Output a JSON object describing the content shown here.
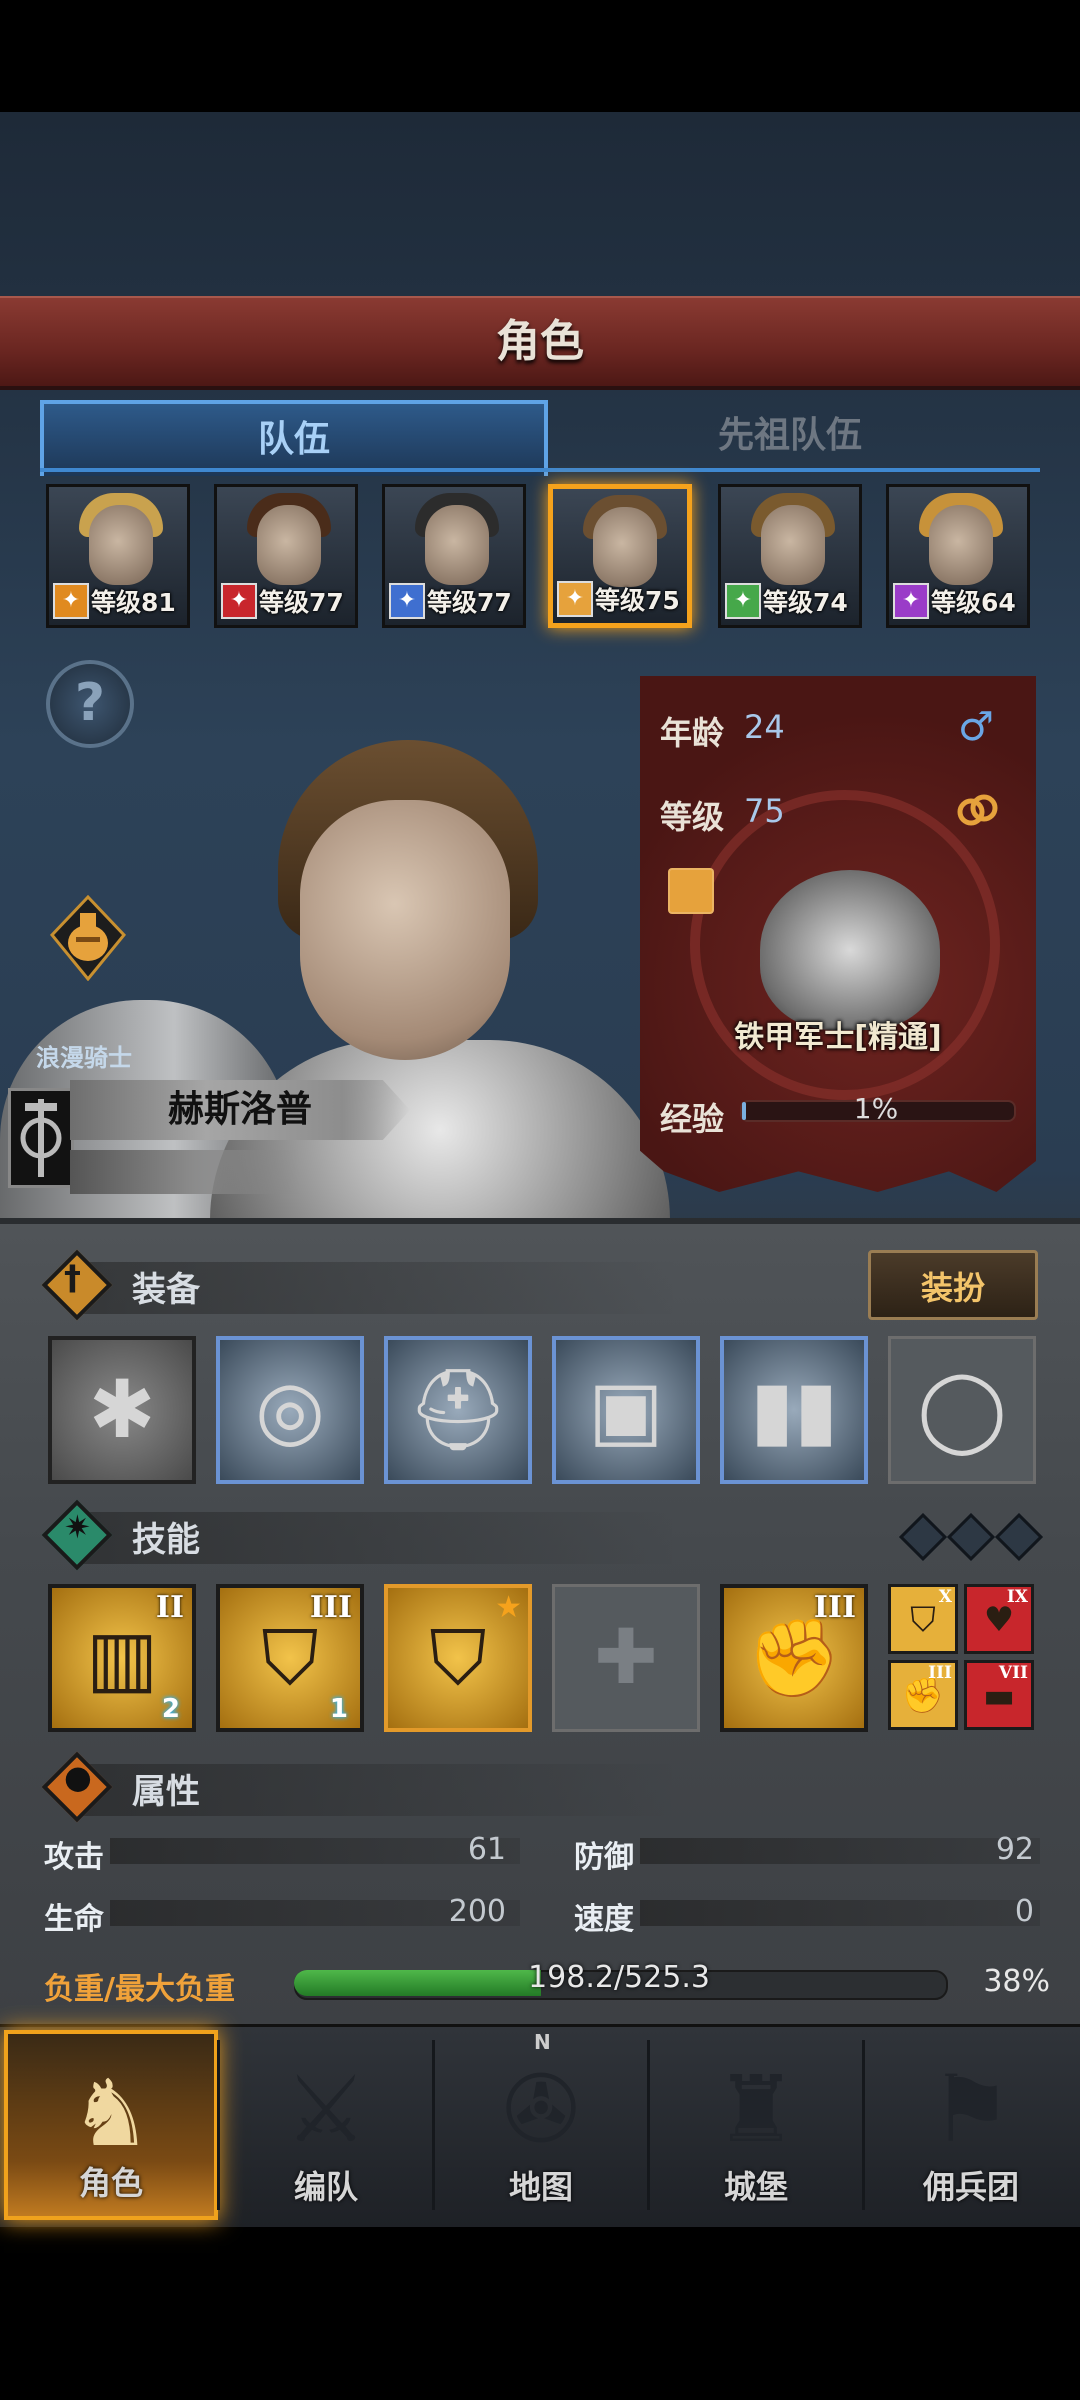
{
  "title": "角色",
  "tabs": [
    {
      "label": "队伍",
      "active": true
    },
    {
      "label": "先祖队伍",
      "active": false
    }
  ],
  "team": [
    {
      "level_label": "等级81",
      "class_icon": "lance-icon",
      "class_color": "#e08a20",
      "hair": "#c9a24e",
      "selected": false
    },
    {
      "level_label": "等级77",
      "class_icon": "horse-icon",
      "class_color": "#c8262c",
      "hair": "#4a2c1a",
      "selected": false
    },
    {
      "level_label": "等级77",
      "class_icon": "sword-icon",
      "class_color": "#3f6fd0",
      "hair": "#2c2c2c",
      "selected": false
    },
    {
      "level_label": "等级75",
      "class_icon": "shield-star-icon",
      "class_color": "#e6a23c",
      "hair": "#6b4f31",
      "selected": true
    },
    {
      "level_label": "等级74",
      "class_icon": "crossbow-icon",
      "class_color": "#46a84a",
      "hair": "#7a5a2e",
      "selected": false
    },
    {
      "level_label": "等级64",
      "class_icon": "staff-icon",
      "class_color": "#9a3cc8",
      "hair": "#c7923a",
      "selected": false
    }
  ],
  "hero": {
    "class_name": "浪漫骑士",
    "name": "赫斯洛普"
  },
  "info": {
    "age_label": "年龄",
    "age_value": "24",
    "gender_icon": "male-icon",
    "level_label": "等级",
    "level_value": "75",
    "ring_icon": "rings-icon",
    "unit_name": "铁甲军士[精通]",
    "exp_label": "经验",
    "exp_value": "1%",
    "exp_fraction": 0.01
  },
  "equipment": {
    "title": "装备",
    "dress_button": "装扮",
    "slots": [
      {
        "name": "flail-icon",
        "glyph": "✱",
        "style": "dark"
      },
      {
        "name": "round-shield-icon",
        "glyph": "◎",
        "style": "blue"
      },
      {
        "name": "great-helm-icon",
        "glyph": "⛑",
        "style": "blue"
      },
      {
        "name": "plate-armor-icon",
        "glyph": "▣",
        "style": "blue"
      },
      {
        "name": "greaves-icon",
        "glyph": "▮▮",
        "style": "blue"
      },
      {
        "name": "ring-slot-icon",
        "glyph": "◯",
        "style": "empty"
      }
    ]
  },
  "skills": {
    "title": "技能",
    "items": [
      {
        "name": "shield-wall-skill-icon",
        "roman": "II",
        "count": "2",
        "glyph": "▥",
        "style": "dark"
      },
      {
        "name": "shield-bash-skill-icon",
        "roman": "III",
        "count": "1",
        "glyph": "⛉",
        "style": "dark"
      },
      {
        "name": "shield-strength-skill-icon",
        "roman": "",
        "count": "",
        "glyph": "⛉",
        "style": "orange"
      },
      {
        "name": "empty-skill-slot-icon",
        "roman": "",
        "count": "",
        "glyph": "✚",
        "style": "empty"
      },
      {
        "name": "strength-fist-skill-icon",
        "roman": "III",
        "count": "",
        "glyph": "✊",
        "style": "dark"
      }
    ],
    "mini": [
      {
        "name": "mini-shield-icon",
        "roman": "X",
        "glyph": "⛉",
        "bg": "#e6b03a"
      },
      {
        "name": "mini-heart-icon",
        "roman": "IX",
        "glyph": "♥",
        "bg": "#c8262c"
      },
      {
        "name": "mini-fist-icon",
        "roman": "III",
        "glyph": "✊",
        "bg": "#e6b03a"
      },
      {
        "name": "mini-dumbbell-icon",
        "roman": "VII",
        "glyph": "▬",
        "bg": "#c8262c"
      }
    ]
  },
  "attributes": {
    "title": "属性",
    "attack_label": "攻击",
    "attack_value": "61",
    "defense_label": "防御",
    "defense_value": "92",
    "life_label": "生命",
    "life_value": "200",
    "speed_label": "速度",
    "speed_value": "0",
    "load_label": "负重/最大负重",
    "load_value": "198.2/525.3",
    "load_percent": "38%",
    "load_fraction": 0.38
  },
  "nav": [
    {
      "label": "角色",
      "icon": "knight-icon",
      "active": true
    },
    {
      "label": "编队",
      "icon": "formation-icon",
      "active": false
    },
    {
      "label": "地图",
      "icon": "compass-map-icon",
      "active": false
    },
    {
      "label": "城堡",
      "icon": "castle-icon",
      "active": false
    },
    {
      "label": "佣兵团",
      "icon": "mercenary-icon",
      "active": false
    }
  ],
  "compass_north": "N",
  "colors": {
    "accent_orange": "#f5a21c",
    "tab_blue": "#3f88d0",
    "title_red": "#7a2c26",
    "load_green": "#3aa43c"
  }
}
